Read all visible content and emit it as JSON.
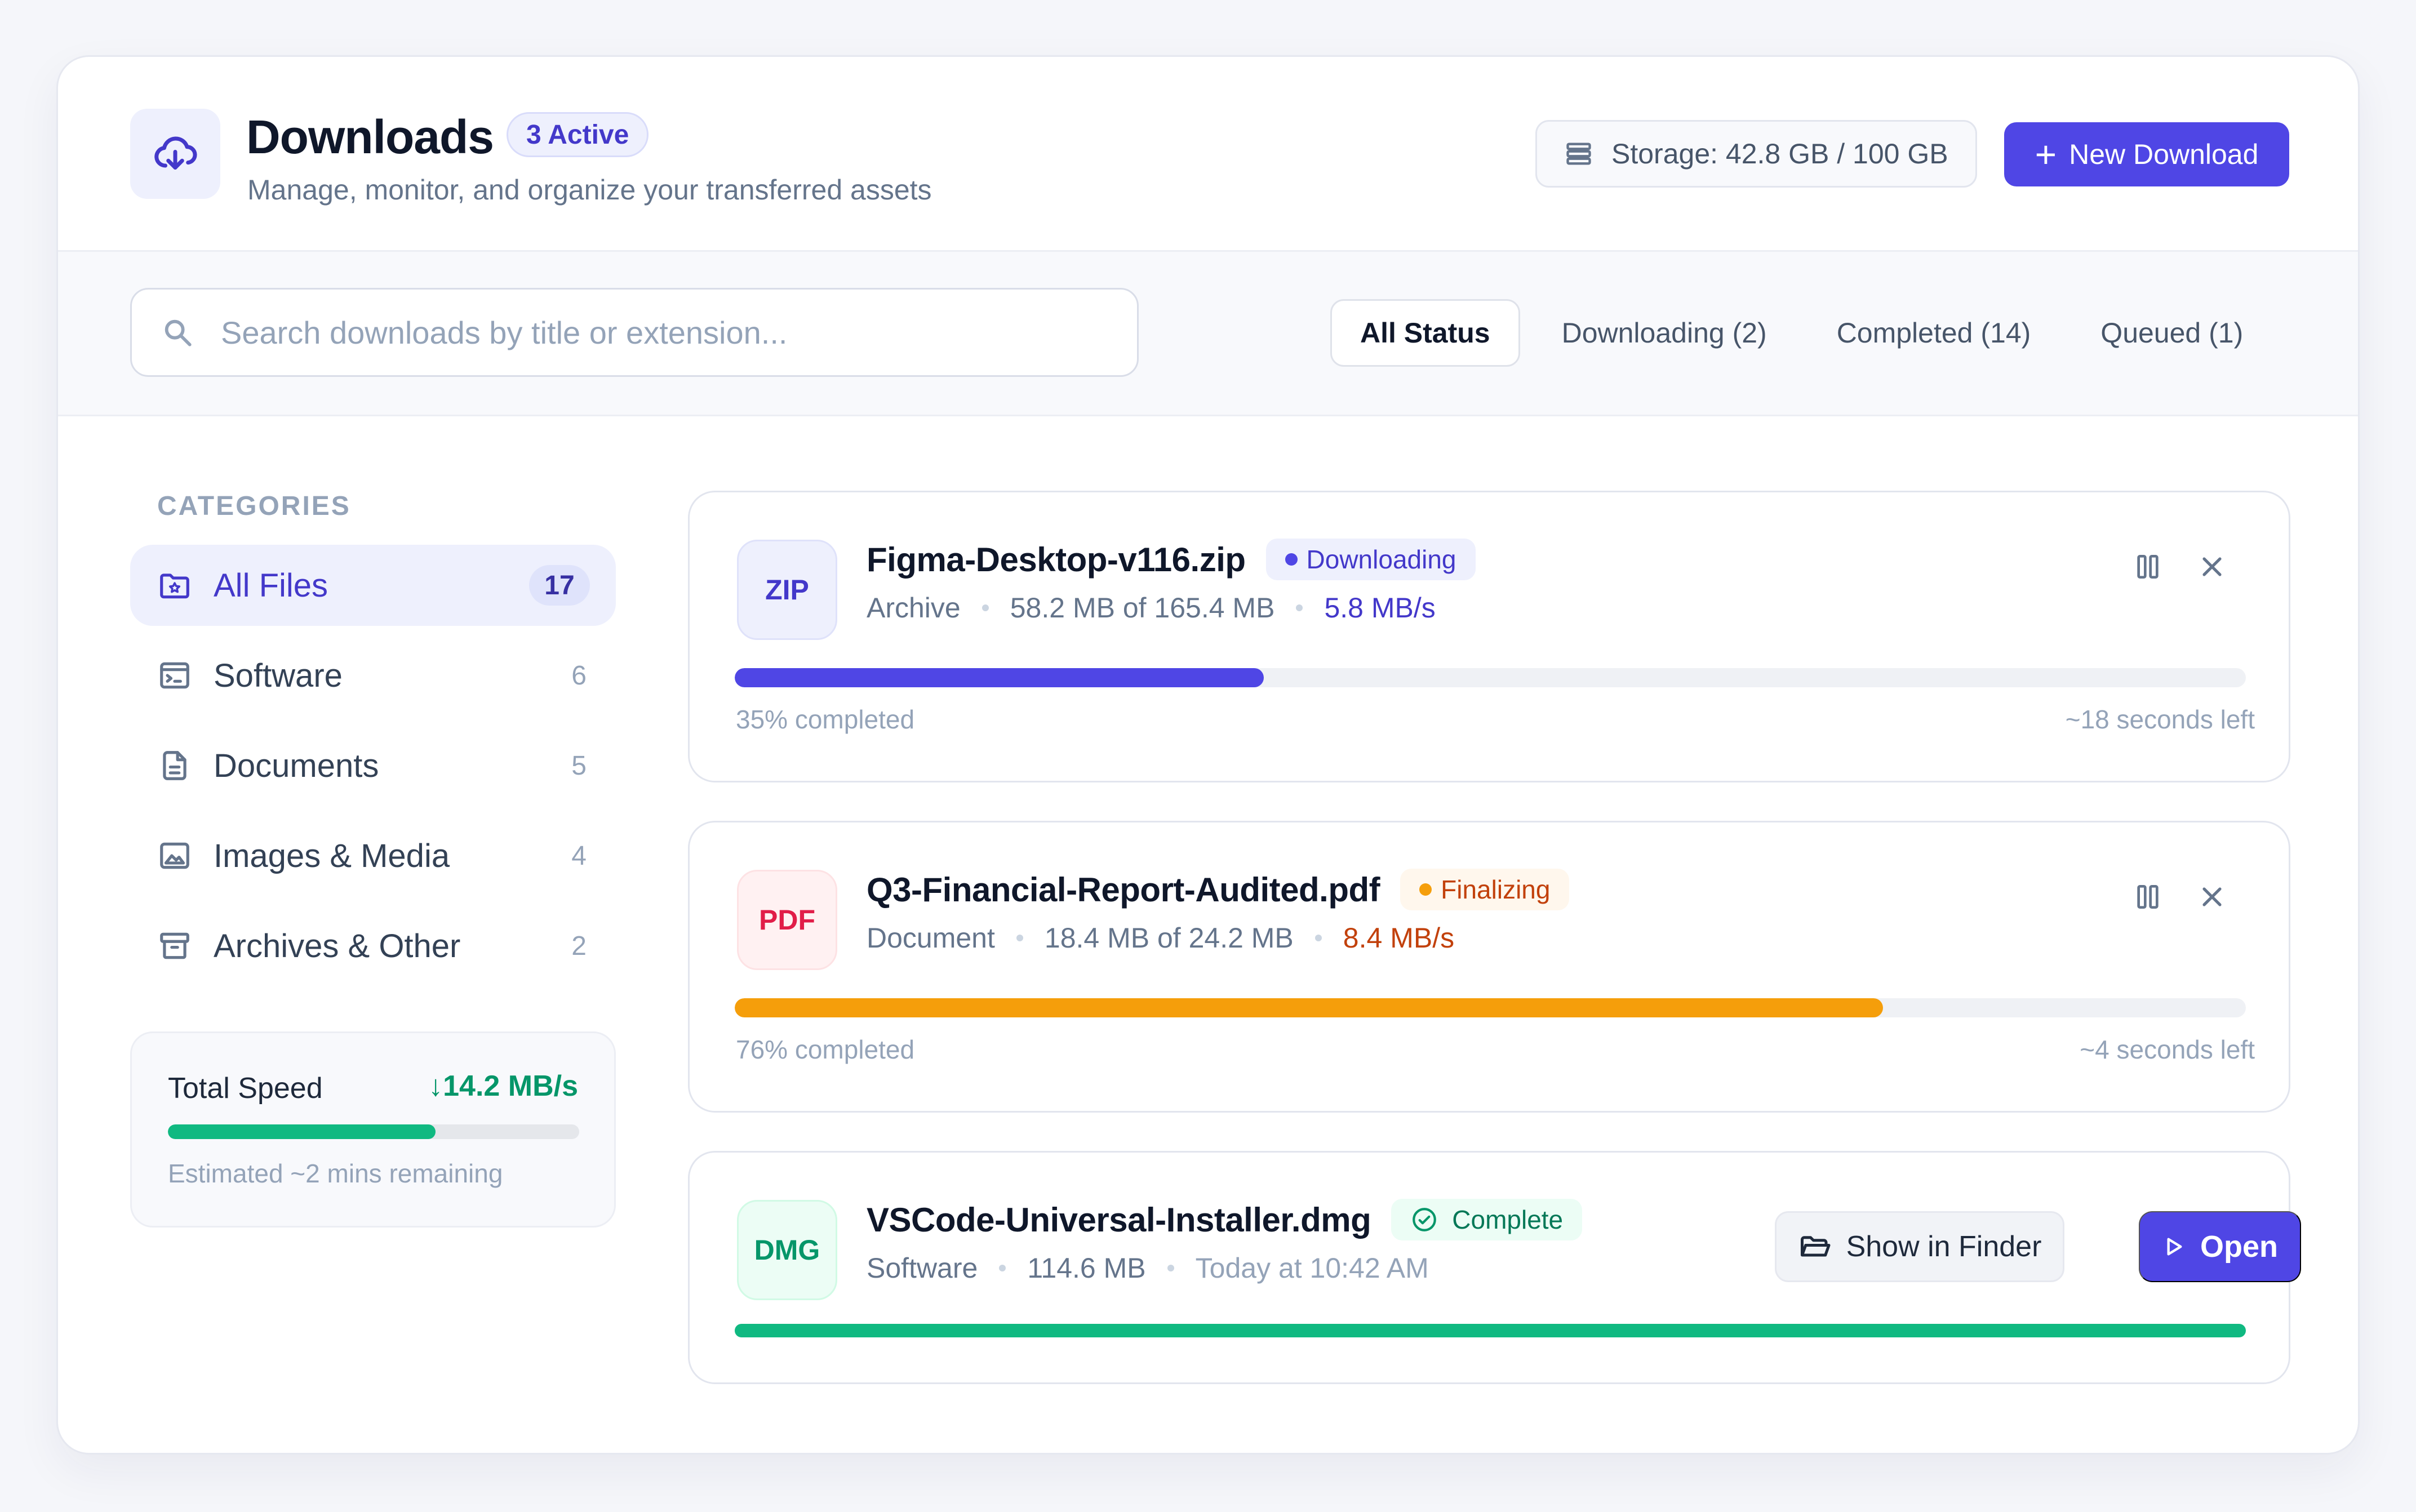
{
  "header": {
    "title": "Downloads",
    "active_badge": "3 Active",
    "subtitle": "Manage, monitor, and organize your transferred assets",
    "storage": "Storage: 42.8 GB / 100 GB",
    "new_download_label": "New Download"
  },
  "search": {
    "placeholder": "Search downloads by title or extension..."
  },
  "filters": [
    {
      "label": "All Status",
      "active": true
    },
    {
      "label": "Downloading (2)"
    },
    {
      "label": "Completed (14)"
    },
    {
      "label": "Queued (1)"
    }
  ],
  "sidebar": {
    "heading": "CATEGORIES",
    "items": [
      {
        "label": "All Files",
        "count": "17",
        "icon": "folder-star-icon",
        "active": true
      },
      {
        "label": "Software",
        "count": "6",
        "icon": "terminal-icon"
      },
      {
        "label": "Documents",
        "count": "5",
        "icon": "document-icon"
      },
      {
        "label": "Images & Media",
        "count": "4",
        "icon": "image-icon"
      },
      {
        "label": "Archives & Other",
        "count": "2",
        "icon": "archive-icon"
      }
    ],
    "speed": {
      "label": "Total Speed",
      "value": "↓14.2 MB/s",
      "progress": 0.65,
      "estimate": "Estimated ~2 mins remaining"
    }
  },
  "downloads": [
    {
      "type_label": "ZIP",
      "name": "Figma-Desktop-v116.zip",
      "status": "Downloading",
      "category": "Archive",
      "size": "58.2 MB of 165.4 MB",
      "rate": "5.8 MB/s",
      "progress": 0.35,
      "progress_text": "35% completed",
      "eta": "~18 seconds left"
    },
    {
      "type_label": "PDF",
      "name": "Q3-Financial-Report-Audited.pdf",
      "status": "Finalizing",
      "category": "Document",
      "size": "18.4 MB of 24.2 MB",
      "rate": "8.4 MB/s",
      "progress": 0.76,
      "progress_text": "76% completed",
      "eta": "~4 seconds left"
    },
    {
      "type_label": "DMG",
      "name": "VSCode-Universal-Installer.dmg",
      "status": "Complete",
      "category": "Software",
      "size": "114.6 MB",
      "time": "Today at 10:42 AM",
      "progress": 1.0,
      "show_in_finder_label": "Show in Finder",
      "open_label": "Open"
    }
  ],
  "colors": {
    "accent": "#4f46e5",
    "success": "#10b981",
    "warning": "#f59e0b",
    "danger": "#e11d48"
  }
}
